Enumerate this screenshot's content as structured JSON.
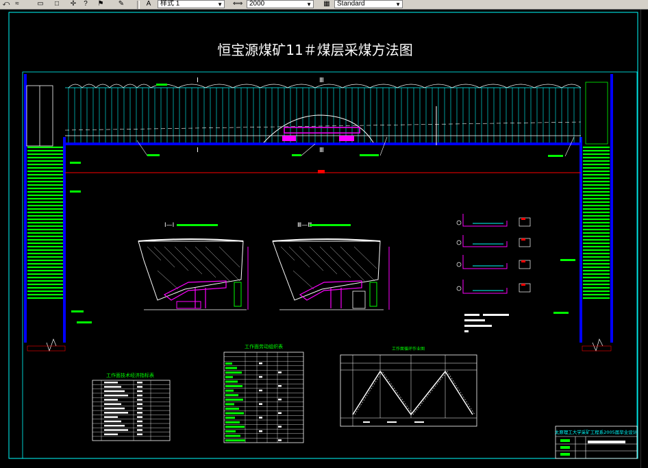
{
  "toolbar": {
    "icons": [
      "undo-arrow-icon",
      "rectangle-icon",
      "square-icon",
      "pin-icon",
      "query-icon",
      "flag-icon",
      "brush-icon"
    ],
    "style_combo": {
      "value": "样式 1",
      "icon": "text-style-icon"
    },
    "scale_combo": {
      "value": "2000",
      "icon": "dimension-scale-icon"
    },
    "standard_combo": {
      "value": "Standard",
      "icon": "table-style-icon"
    }
  },
  "drawing": {
    "title": "恒宝源煤矿11＃煤层采煤方法图",
    "section_marks": {
      "one": "Ⅰ",
      "three": "Ⅲ"
    },
    "section1_title": "Ⅰ—Ⅰ",
    "section3_title": "Ⅲ—Ⅲ",
    "table1_title": "工作面技术经济指标表",
    "table2_title": "工作面劳动组织表",
    "chart_title": "工作面循环作业图",
    "title_block": {
      "school": "太原理工大学采矿工程系2005届毕业设计"
    },
    "colors": {
      "background": "#000000",
      "roadway": "#0000ff",
      "support": "#00ffff",
      "equipment": "#ff00ff",
      "labels": "#00ff00",
      "lines": "#ffffff",
      "marker": "#ff0000"
    }
  }
}
